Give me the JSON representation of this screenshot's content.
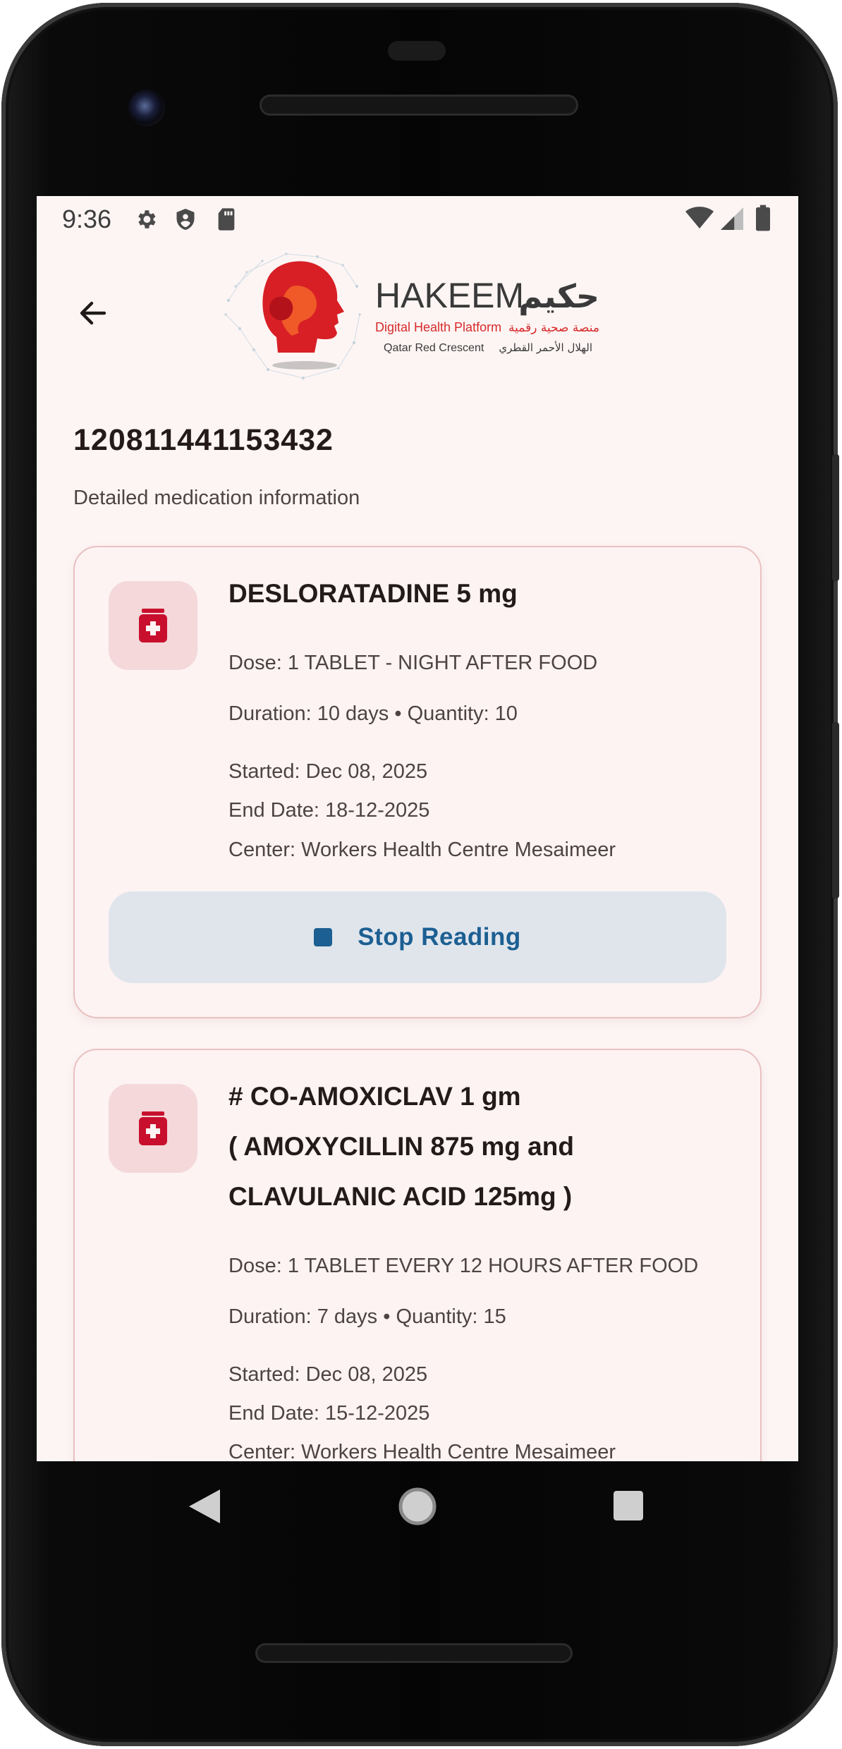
{
  "status_bar": {
    "time": "9:36",
    "left_icons": [
      "gear-icon",
      "shield-icon",
      "sd-card-icon"
    ],
    "right_icons": [
      "wifi-icon",
      "cell-signal-icon",
      "battery-icon"
    ]
  },
  "header": {
    "back_icon": "arrow-left-icon",
    "logo": {
      "name_en": "HAKEEM",
      "name_ar": "حكيم",
      "tagline_en": "Digital Health Platform",
      "tagline_ar": "منصة صحية رقمية",
      "org_en": "Qatar Red Crescent",
      "org_ar": "الهلال الأحمر القطري"
    }
  },
  "page": {
    "title": "120811441153432",
    "subtitle": "Detailed medication information"
  },
  "medications": [
    {
      "icon": "medicine-bottle-icon",
      "name_lines": [
        "DESLORATADINE 5 mg"
      ],
      "dose": "Dose: 1 TABLET - NIGHT AFTER FOOD",
      "duration": "Duration: 10 days • Quantity: 10",
      "started": "Started: Dec 08, 2025",
      "end_date": "End Date: 18-12-2025",
      "center": "Center: Workers Health Centre Mesaimeer",
      "action_label": "Stop Reading",
      "action_icon": "stop-icon"
    },
    {
      "icon": "medicine-bottle-icon",
      "name_lines": [
        "# CO-AMOXICLAV 1 gm",
        "( AMOXYCILLIN  875 mg  and",
        "CLAVULANIC ACID 125mg )"
      ],
      "dose": "Dose: 1 TABLET EVERY 12 HOURS AFTER FOOD",
      "duration": "Duration: 7 days • Quantity: 15",
      "started": "Started: Dec 08, 2025",
      "end_date": "End Date: 15-12-2025",
      "center": "Center: Workers Health Centre Mesaimeer"
    }
  ],
  "nav_bar": {
    "back": "nav-back-icon",
    "home": "nav-home-icon",
    "recents": "nav-recents-icon"
  },
  "colors": {
    "screen_bg": "#fdf5f4",
    "card_border": "#e9c1c1",
    "icon_tile": "#f4d8da",
    "accent_red": "#c8102e",
    "button_bg": "#e0e5ec",
    "button_text": "#1c5f92"
  }
}
